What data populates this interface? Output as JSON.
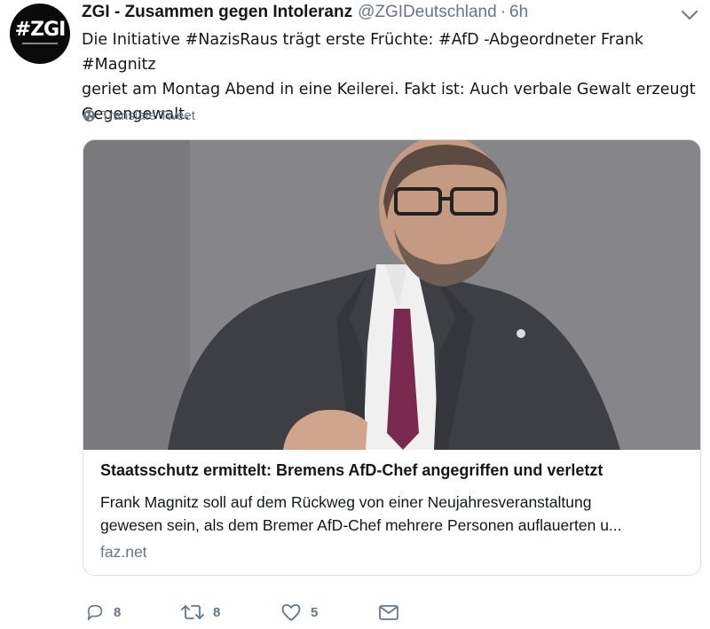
{
  "tweet": {
    "display_name": "ZGI - Zusammen gegen Intoleranz",
    "handle": "@ZGIDeutschland",
    "separator": "·",
    "time": "6h",
    "avatar_text": "#ZGI",
    "text_lines": [
      "Die Initiative #NazisRaus trägt erste Früchte: #AfD -Abgeordneter Frank #Magnitz",
      "geriet am Montag Abend in eine Keilerei. Fakt ist: Auch verbale Gewalt erzeugt",
      "Gegengewalt."
    ],
    "translate_label": "Translate Tweet"
  },
  "card": {
    "title": "Staatsschutz ermittelt: Bremens AfD-Chef angegriffen und verletzt",
    "description_lines": [
      "Frank Magnitz soll auf dem Rückweg von einer Neujahresveranstaltung",
      "gewesen sein, als dem Bremer AfD-Chef mehrere Personen auflauerten u..."
    ],
    "domain": "faz.net"
  },
  "actions": {
    "reply_count": "8",
    "retweet_count": "8",
    "like_count": "5"
  },
  "colors": {
    "text": "#14171a",
    "secondary": "#657786",
    "border": "#d8dfe5",
    "tie": "#7a2a4e"
  },
  "icons": [
    "chevron-down-icon",
    "globe-icon",
    "reply-icon",
    "retweet-icon",
    "like-icon",
    "message-icon"
  ]
}
